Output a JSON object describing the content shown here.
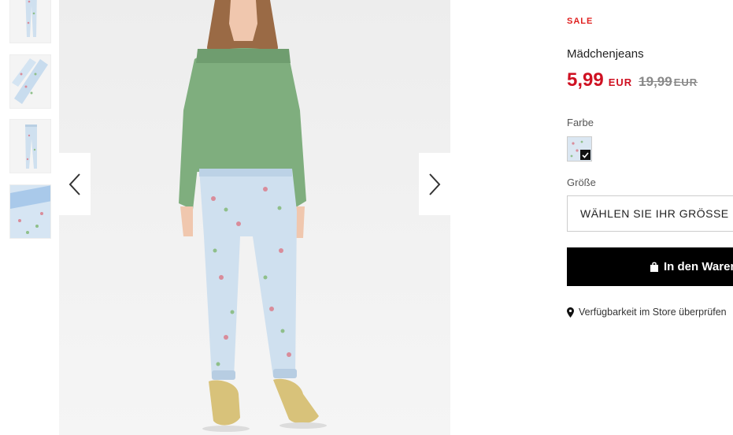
{
  "gallery": {
    "thumbnails": [
      {
        "alt": "front"
      },
      {
        "alt": "detail"
      },
      {
        "alt": "flat"
      },
      {
        "alt": "fabric"
      }
    ],
    "prev_icon": "chevron-left-icon",
    "next_icon": "chevron-right-icon"
  },
  "product": {
    "badge": "SALE",
    "title": "Mädchenjeans",
    "price": "5,99",
    "currency": "EUR",
    "old_price": "19,99",
    "old_currency": "EUR",
    "color_label": "Farbe",
    "size_label": "Größe",
    "size_placeholder": "WÄHLEN SIE IHR GRÖSSE",
    "cart_label": "In den Warenkorb",
    "store_link": "Verfügbarkeit im Store überprüfen"
  },
  "colors": {
    "sale": "#e0201f",
    "price": "#cf1122",
    "old_price": "#888888",
    "button_bg": "#000000",
    "button_text": "#ffffff"
  }
}
